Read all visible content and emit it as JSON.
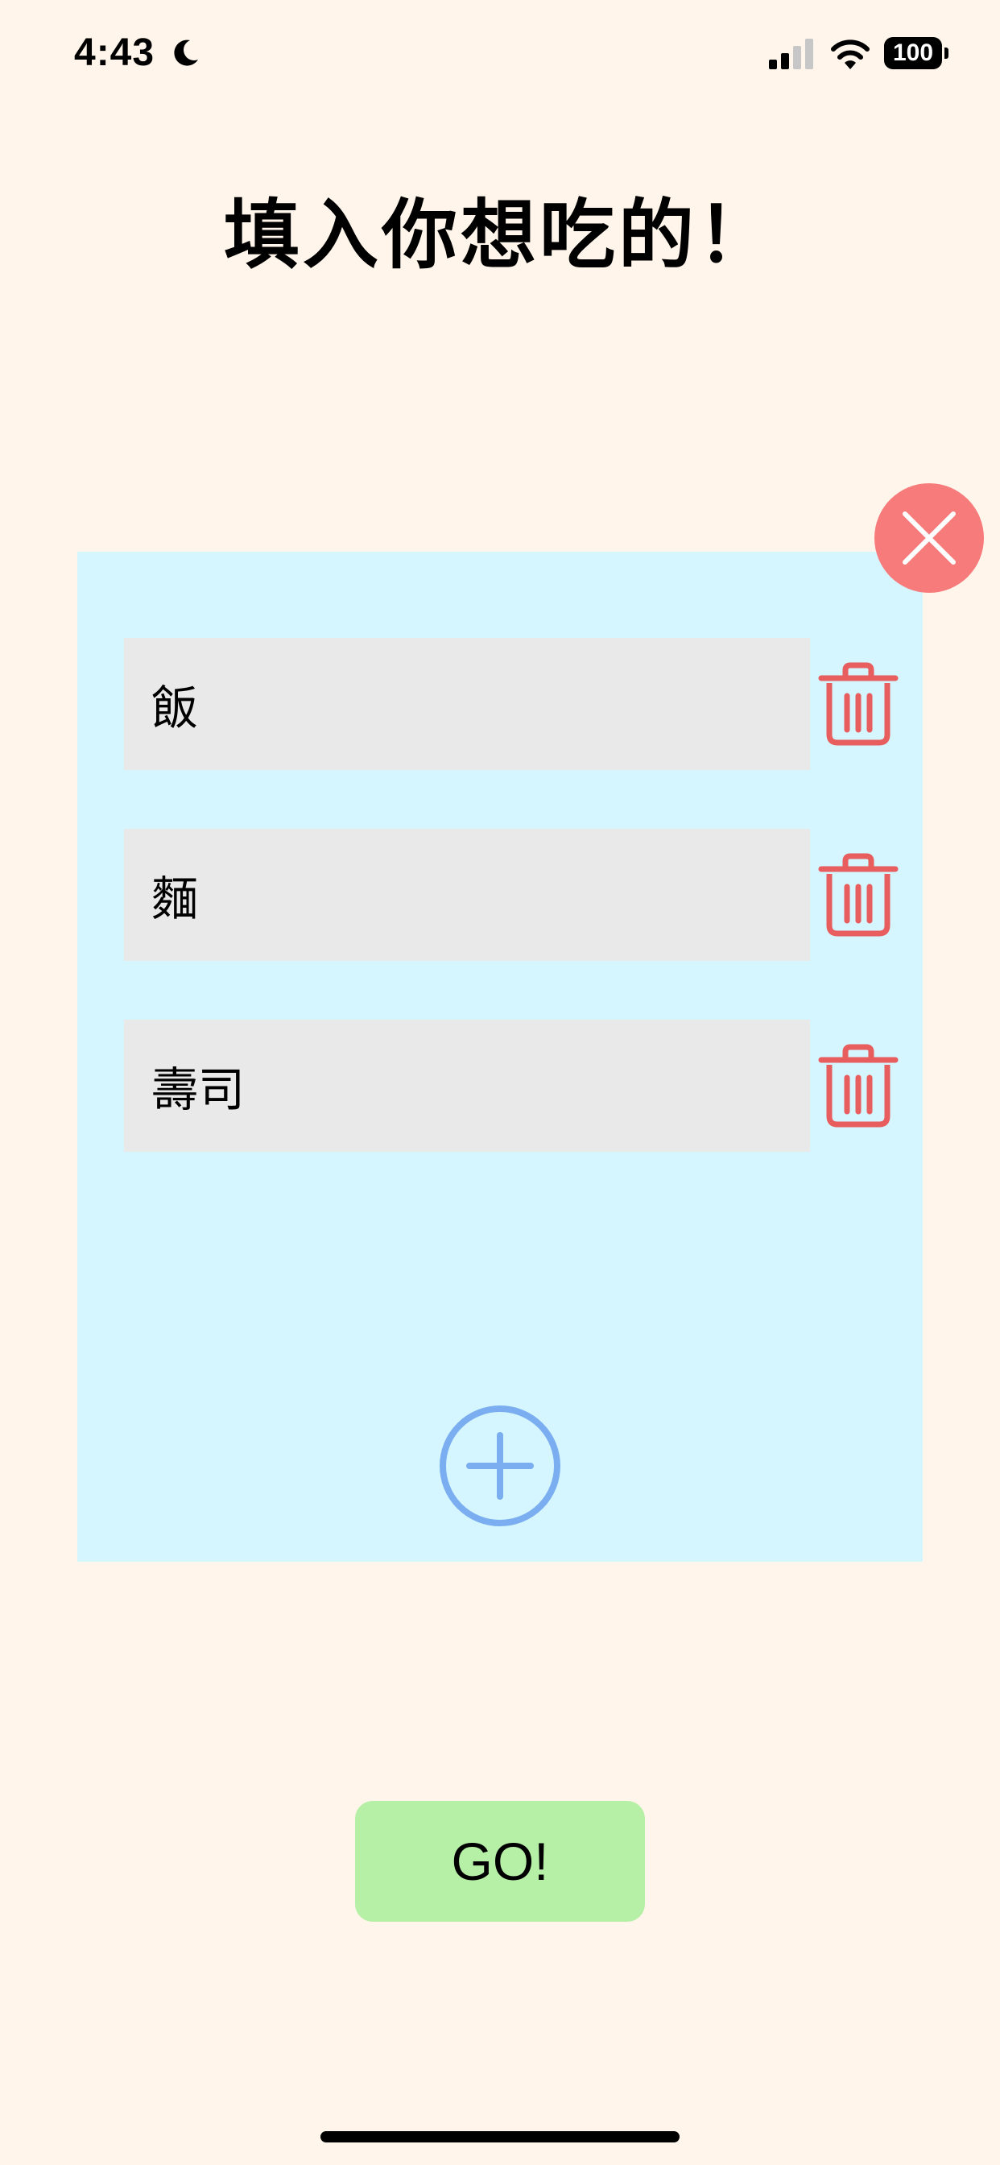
{
  "status_bar": {
    "time": "4:43",
    "battery_level": "100",
    "icons": [
      "moon-icon",
      "signal-icon",
      "wifi-icon",
      "battery-icon"
    ]
  },
  "title": "填入你想吃的！",
  "food_items": [
    {
      "value": "飯"
    },
    {
      "value": "麵"
    },
    {
      "value": "壽司"
    }
  ],
  "buttons": {
    "go_label": "GO!",
    "add_icon": "plus-circle-icon",
    "delete_icon": "trash-icon",
    "close_icon": "close-icon"
  },
  "colors": {
    "background": "#fff5ea",
    "panel": "#d5f5ff",
    "close_button": "#f77b7b",
    "trash": "#e85d5d",
    "add": "#7aaef0",
    "go_button": "#b6efa6",
    "input_bg": "#e9e9e9"
  }
}
